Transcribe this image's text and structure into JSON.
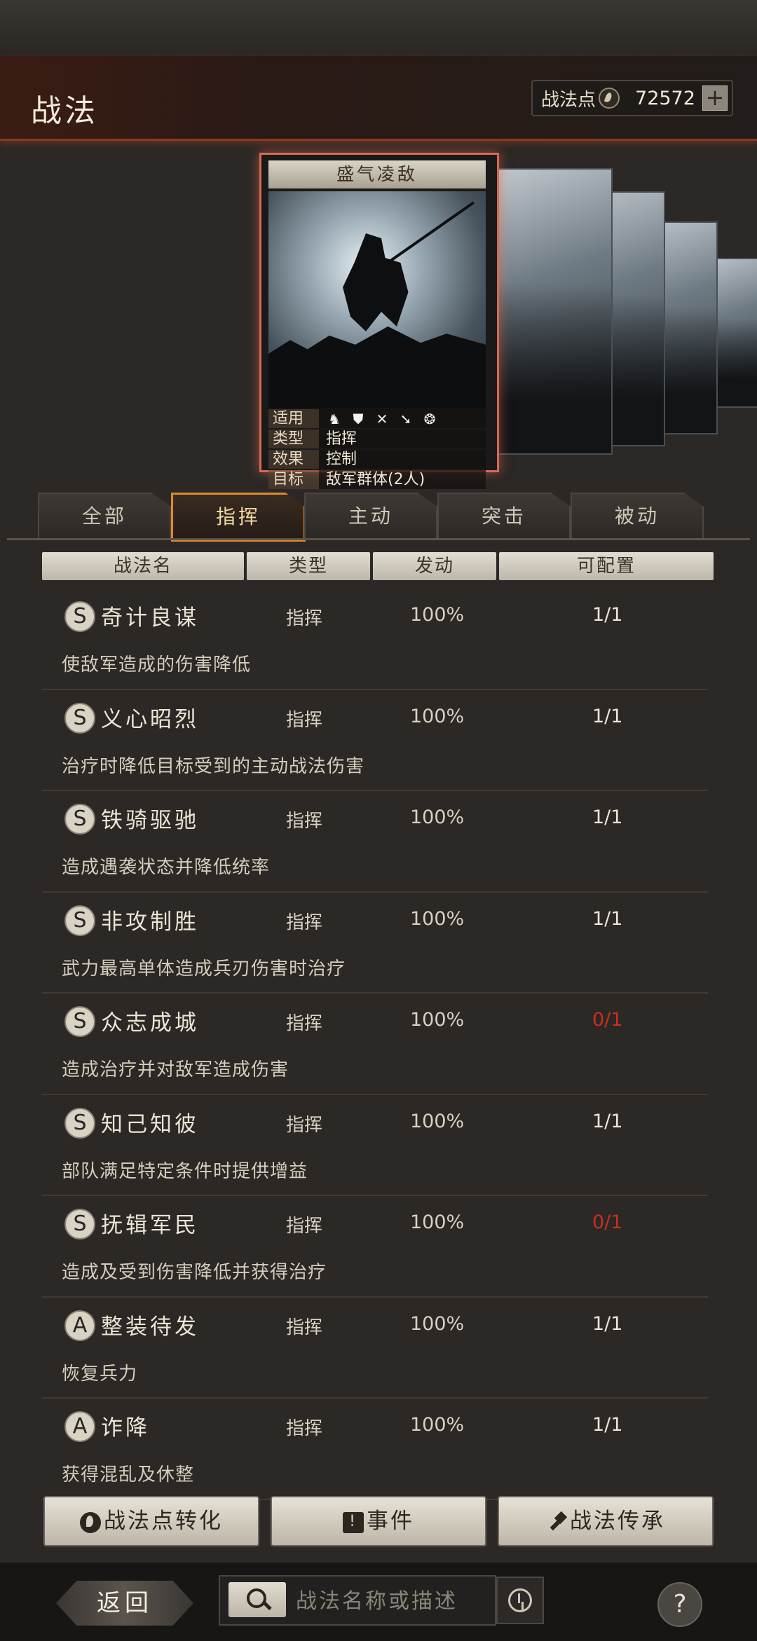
{
  "header": {
    "title": "战法",
    "points_label": "战法点",
    "points_value": "72572",
    "plus_label": "+"
  },
  "card": {
    "name": "盛气凌敌",
    "info": [
      {
        "key": "适用",
        "value": ""
      },
      {
        "key": "类型",
        "value": "指挥"
      },
      {
        "key": "效果",
        "value": "控制"
      },
      {
        "key": "目标",
        "value": "敌军群体(2人)"
      }
    ],
    "unit_icons": [
      "cavalry-icon",
      "shield-icon",
      "archer-icon",
      "spear-icon",
      "chariot-icon"
    ]
  },
  "tabs": [
    "全部",
    "指挥",
    "主动",
    "突击",
    "被动"
  ],
  "active_tab": "指挥",
  "columns": [
    "战法名",
    "类型",
    "发动",
    "可配置"
  ],
  "skills": [
    {
      "grade": "S",
      "name": "奇计良谋",
      "type": "指挥",
      "rate": "100%",
      "config": "1/1",
      "desc": "使敌军造成的伤害降低",
      "warn": false
    },
    {
      "grade": "S",
      "name": "义心昭烈",
      "type": "指挥",
      "rate": "100%",
      "config": "1/1",
      "desc": "治疗时降低目标受到的主动战法伤害",
      "warn": false
    },
    {
      "grade": "S",
      "name": "铁骑驱驰",
      "type": "指挥",
      "rate": "100%",
      "config": "1/1",
      "desc": "造成遇袭状态并降低统率",
      "warn": false
    },
    {
      "grade": "S",
      "name": "非攻制胜",
      "type": "指挥",
      "rate": "100%",
      "config": "1/1",
      "desc": "武力最高单体造成兵刃伤害时治疗",
      "warn": false
    },
    {
      "grade": "S",
      "name": "众志成城",
      "type": "指挥",
      "rate": "100%",
      "config": "0/1",
      "desc": "造成治疗并对敌军造成伤害",
      "warn": true
    },
    {
      "grade": "S",
      "name": "知己知彼",
      "type": "指挥",
      "rate": "100%",
      "config": "1/1",
      "desc": "部队满足特定条件时提供增益",
      "warn": false
    },
    {
      "grade": "S",
      "name": "抚辑军民",
      "type": "指挥",
      "rate": "100%",
      "config": "0/1",
      "desc": "造成及受到伤害降低并获得治疗",
      "warn": true
    },
    {
      "grade": "A",
      "name": "整装待发",
      "type": "指挥",
      "rate": "100%",
      "config": "1/1",
      "desc": "恢复兵力",
      "warn": false
    },
    {
      "grade": "A",
      "name": "诈降",
      "type": "指挥",
      "rate": "100%",
      "config": "1/1",
      "desc": "获得混乱及休整",
      "warn": false
    }
  ],
  "buttons": {
    "convert": "战法点转化",
    "events": "事件",
    "inherit": "战法传承"
  },
  "footer": {
    "back": "返回",
    "search_placeholder": "战法名称或描述",
    "help": "?"
  },
  "colors": {
    "accent_orange": "#e08a2a",
    "card_border": "#d56a52",
    "warn_red": "#c8301f"
  }
}
